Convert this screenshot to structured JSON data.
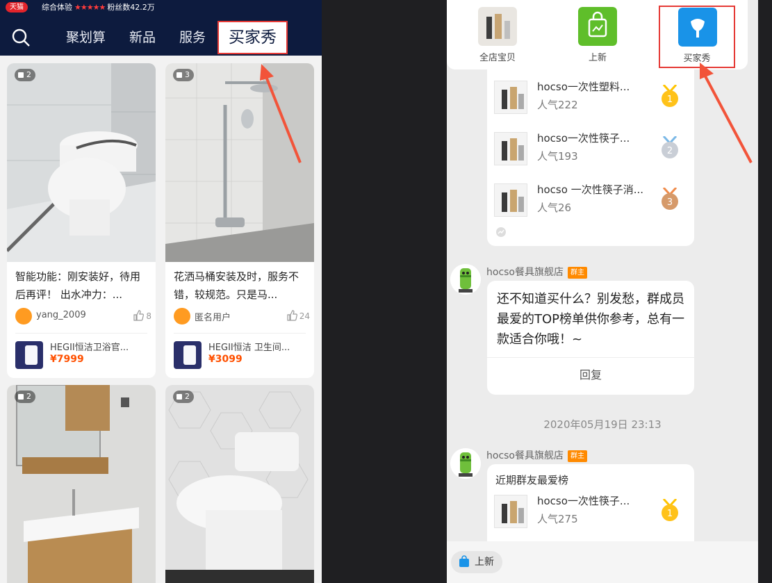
{
  "left": {
    "store": {
      "badge": "天猫",
      "score_label": "综合体验",
      "stars": "★★★★★",
      "fans": "粉丝数42.2万"
    },
    "nav": {
      "tabs": [
        {
          "label": "聚划算"
        },
        {
          "label": "新品"
        },
        {
          "label": "服务"
        },
        {
          "label": "买家秀"
        }
      ],
      "active_index": 3
    },
    "cards": [
      {
        "count": "2",
        "title": "智能功能：刚安装好，待用后再评！ 出水冲力：...",
        "user": "yang_2009",
        "likes": "8",
        "product": "HEGII恒洁卫浴官...",
        "price": "¥7999"
      },
      {
        "count": "3",
        "title": "花洒马桶安装及时，服务不错，较规范。只是马...",
        "user": "匿名用户",
        "likes": "24",
        "product": "HEGII恒洁 卫生间...",
        "price": "¥3099"
      },
      {
        "count": "2"
      },
      {
        "count": "2"
      }
    ]
  },
  "right": {
    "shop_menu": [
      {
        "label": "全店宝贝"
      },
      {
        "label": "上新"
      },
      {
        "label": "买家秀"
      }
    ],
    "rank_top": [
      {
        "name": "hocso一次性塑料...",
        "popularity": "人气222",
        "rank": "1"
      },
      {
        "name": "hocso一次性筷子...",
        "popularity": "人气193",
        "rank": "2"
      },
      {
        "name": "hocso 一次性筷子消...",
        "popularity": "人气26",
        "rank": "3"
      }
    ],
    "message": {
      "shop": "hocso餐具旗舰店",
      "badge": "群主",
      "text": "还不知道买什么？别发愁，群成员最爱的TOP榜单供你参考，总有一款适合你哦！~",
      "reply": "回复"
    },
    "timestamp": "2020年05月19日 23:13",
    "message2": {
      "shop": "hocso餐具旗舰店",
      "badge": "群主",
      "heading": "近期群友最爱榜",
      "item": {
        "name": "hocso一次性筷子...",
        "popularity": "人气275",
        "rank": "1"
      }
    },
    "bottom": {
      "chip": "上新"
    }
  },
  "colors": {
    "navy": "#0d1b3e",
    "highlight_red": "#e53935",
    "price_orange": "#ff5000",
    "badge_orange": "#ff8a00"
  }
}
